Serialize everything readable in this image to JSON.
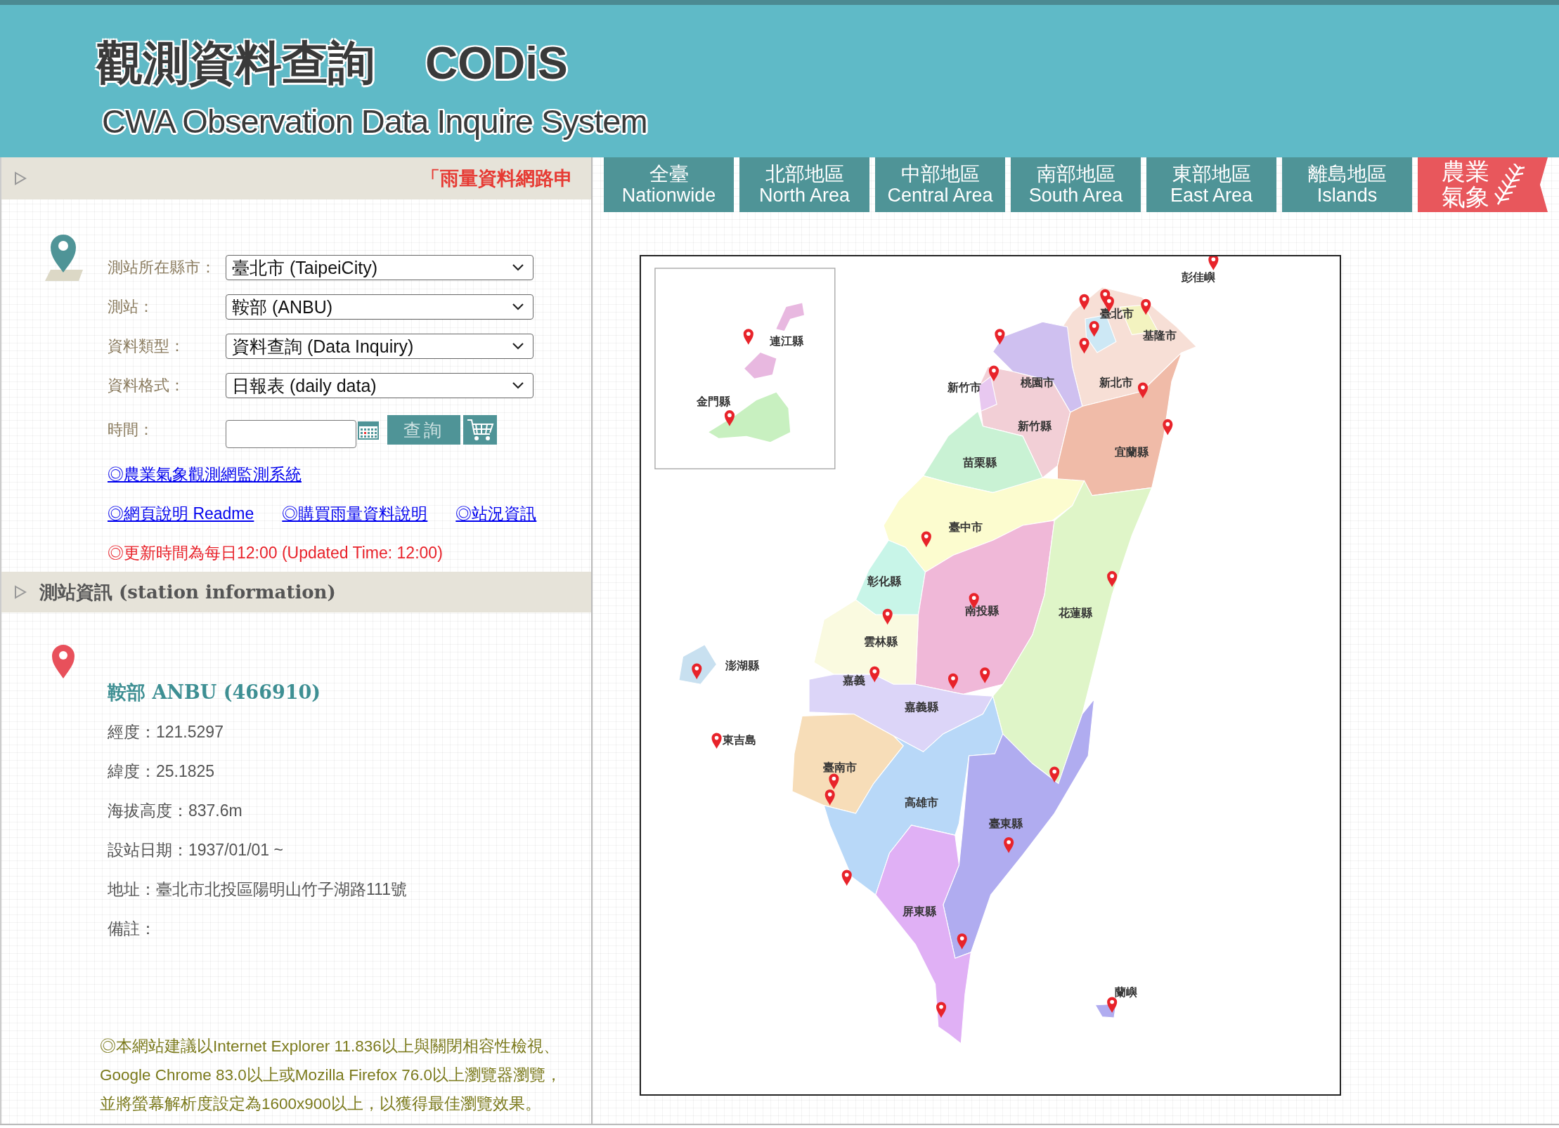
{
  "header": {
    "title": "觀測資料查詢",
    "brand": "CODiS",
    "subtitle": "CWA Observation Data Inquire System"
  },
  "left_panel": {
    "notice": "「雨量資料網路申",
    "form": [
      {
        "kind": "select",
        "label": "測站所在縣市：",
        "value": "臺北市 (TaipeiCity)"
      },
      {
        "kind": "select",
        "label": "測站：",
        "value": "鞍部 (ANBU)"
      },
      {
        "kind": "select",
        "label": "資料類型：",
        "value": "資料查詢 (Data Inquiry)"
      },
      {
        "kind": "select",
        "label": "資料格式：",
        "value": "日報表 (daily data)"
      },
      {
        "kind": "date",
        "label": "時間："
      }
    ],
    "query_button": "查詢",
    "link_rows": [
      [
        "◎農業氣象觀測網監測系統"
      ],
      [
        "◎網頁說明 Readme",
        "◎購買雨量資料說明",
        "◎站況資訊"
      ]
    ],
    "update_note": "◎更新時間為每日12:00 (Updated Time: 12:00)"
  },
  "station_info": {
    "heading": "測站資訊 (station information)",
    "name": "鞍部 ANBU (466910)",
    "details": [
      "經度：121.5297",
      "緯度：25.1825",
      "海拔高度：837.6m",
      "設站日期：1937/01/01 ~",
      "地址：臺北市北投區陽明山竹子湖路111號",
      "備註："
    ]
  },
  "browser_note": [
    "◎本網站建議以Internet Explorer 11.836以上與關閉相容性檢視、",
    "Google Chrome 83.0以上或Mozilla Firefox 76.0以上瀏覽器瀏覽，",
    "並將螢幕解析度設定為1600x900以上，以獲得最佳瀏覽效果。"
  ],
  "tabs": [
    {
      "kind": "region",
      "lines": [
        "全臺",
        "Nationwide"
      ]
    },
    {
      "kind": "region",
      "lines": [
        "北部地區",
        "North Area"
      ]
    },
    {
      "kind": "region",
      "lines": [
        "中部地區",
        "Central Area"
      ]
    },
    {
      "kind": "region",
      "lines": [
        "南部地區",
        "South Area"
      ]
    },
    {
      "kind": "region",
      "lines": [
        "東部地區",
        "East Area"
      ]
    },
    {
      "kind": "region",
      "lines": [
        "離島地區",
        "Islands"
      ]
    },
    {
      "kind": "agri",
      "lines": [
        "農業",
        "氣象"
      ]
    }
  ],
  "map": {
    "labels": [
      "彭佳嶼",
      "臺北市",
      "基隆市",
      "連江縣",
      "金門縣",
      "新竹市",
      "桃園市",
      "新北市",
      "新竹縣",
      "宜蘭縣",
      "苗栗縣",
      "臺中市",
      "彰化縣",
      "南投縣",
      "花蓮縣",
      "雲林縣",
      "澎湖縣",
      "嘉義",
      "嘉義縣",
      "東吉島",
      "臺南市",
      "高雄市",
      "臺東縣",
      "屏東縣",
      "蘭嶼"
    ]
  }
}
